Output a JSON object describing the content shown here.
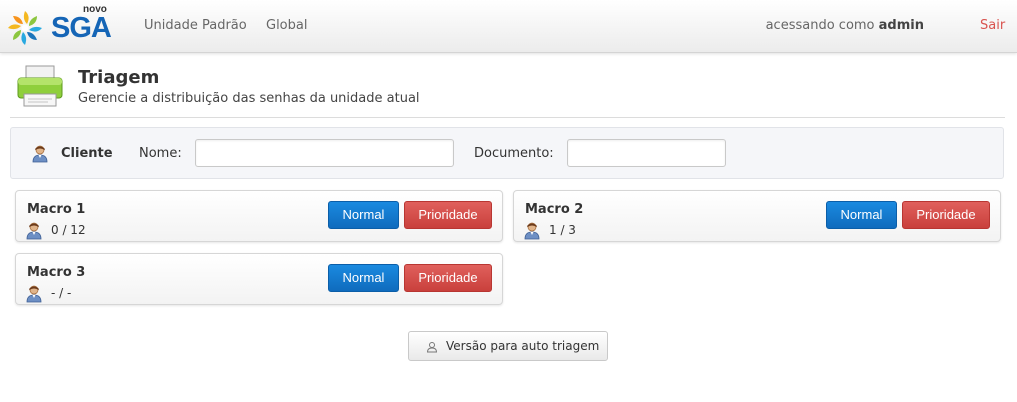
{
  "navbar": {
    "logo_small": "novo",
    "logo_text": "SGA",
    "items": [
      "Unidade Padrão",
      "Global"
    ],
    "user_prefix": "acessando como",
    "user_name": "admin",
    "logout": "Sair",
    "logout_color": "#d9534f"
  },
  "header": {
    "icon": "printer-icon",
    "title": "Triagem",
    "subtitle": "Gerencie a distribuição das senhas da unidade atual"
  },
  "cliente": {
    "icon": "user-icon",
    "label": "Cliente",
    "nome_label": "Nome:",
    "nome_value": "",
    "documento_label": "Documento:",
    "documento_value": ""
  },
  "services": [
    {
      "name": "Macro 1",
      "count": "0 / 12",
      "normal": "Normal",
      "prioridade": "Prioridade"
    },
    {
      "name": "Macro 2",
      "count": "1 / 3",
      "normal": "Normal",
      "prioridade": "Prioridade"
    },
    {
      "name": "Macro 3",
      "count": "- / -",
      "normal": "Normal",
      "prioridade": "Prioridade"
    }
  ],
  "colors": {
    "normal_button": "#1479cc",
    "priority_button": "#d34f4b",
    "brand": "#1565b6"
  },
  "auto_triagem": {
    "icon": "user-outline-icon",
    "label": "Versão para auto triagem"
  }
}
